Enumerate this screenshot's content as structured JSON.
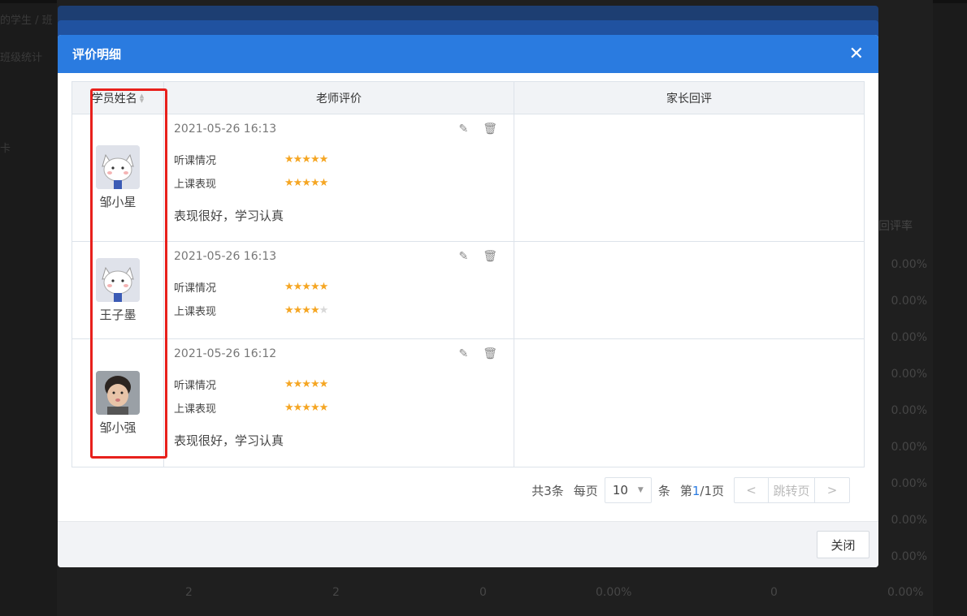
{
  "background": {
    "crumb": "的学生 / 班",
    "sub": "班级统计",
    "misc": "卡",
    "col_head": "回评率",
    "rates": [
      "0.00%",
      "0.00%",
      "0.00%",
      "0.00%",
      "0.00%",
      "0.00%",
      "0.00%",
      "0.00%",
      "0.00%"
    ],
    "bottom_row": [
      "2",
      "2",
      "0",
      "0.00%",
      "0",
      "0.00%"
    ]
  },
  "modal": {
    "title": "评价明细",
    "close_icon": "close-icon",
    "columns": {
      "student": "学员姓名",
      "teacher": "老师评价",
      "parent": "家长回评"
    },
    "criteria": [
      "听课情况",
      "上课表现"
    ],
    "rows": [
      {
        "student": "邹小星",
        "avatar": "cat-avatar",
        "time": "2021-05-26 16:13",
        "ratings": [
          5,
          5
        ],
        "comment": "表现很好，学习认真",
        "parent_reply": ""
      },
      {
        "student": "王子墨",
        "avatar": "cat-avatar",
        "time": "2021-05-26 16:13",
        "ratings": [
          5,
          4
        ],
        "comment": "",
        "parent_reply": ""
      },
      {
        "student": "邹小强",
        "avatar": "child-photo-avatar",
        "time": "2021-05-26 16:12",
        "ratings": [
          5,
          5
        ],
        "comment": "表现很好，学习认真",
        "parent_reply": ""
      }
    ],
    "pager": {
      "total": "共3条",
      "per_page_label": "每页",
      "per_page": "10",
      "unit": "条",
      "page_prefix": "第",
      "page_current": "1",
      "page_suffix": "/1页",
      "prev": "<",
      "jump": "跳转页",
      "next": ">"
    },
    "footer": {
      "close_label": "关闭"
    }
  },
  "colors": {
    "header_blue": "#2a7be0",
    "star": "#f5a623",
    "highlight_red": "#e8201c"
  }
}
